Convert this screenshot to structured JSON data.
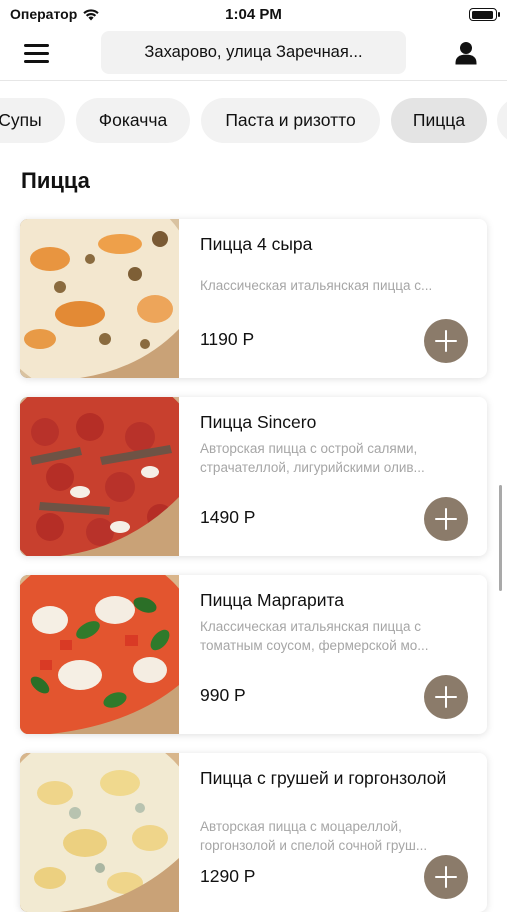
{
  "status_bar": {
    "carrier": "Оператор",
    "time": "1:04 PM"
  },
  "header": {
    "address": "Захарово, улица Заречная..."
  },
  "categories": [
    {
      "label": "Супы"
    },
    {
      "label": "Фокачча"
    },
    {
      "label": "Паста и ризотто"
    },
    {
      "label": "Пицца",
      "selected": true
    }
  ],
  "section": {
    "title": "Пицца"
  },
  "products": [
    {
      "name": "Пицца 4 сыра",
      "description": "Классическая итальянская пицца с...",
      "price": "1190 Р"
    },
    {
      "name": "Пицца Sincero",
      "description": "Авторская пицца с острой салями, страчателлой, лигурийскими олив...",
      "price": "1490 Р"
    },
    {
      "name": "Пицца Маргарита",
      "description": "Классическая итальянская пицца с томатным соусом, фермерской мо...",
      "price": "990 Р"
    },
    {
      "name": "Пицца с грушей и горгонзолой",
      "description": "Авторская пицца с моцареллой, горгонзолой и спелой сочной груш...",
      "price": "1290 Р"
    }
  ],
  "colors": {
    "accent": "#8b7b6a",
    "chip_bg": "#f2f2f2",
    "chip_active_bg": "#e4e4e4",
    "muted_text": "#a6a6a6"
  },
  "icons": [
    "wifi-icon",
    "battery-icon",
    "menu-icon",
    "user-icon",
    "plus-icon"
  ]
}
